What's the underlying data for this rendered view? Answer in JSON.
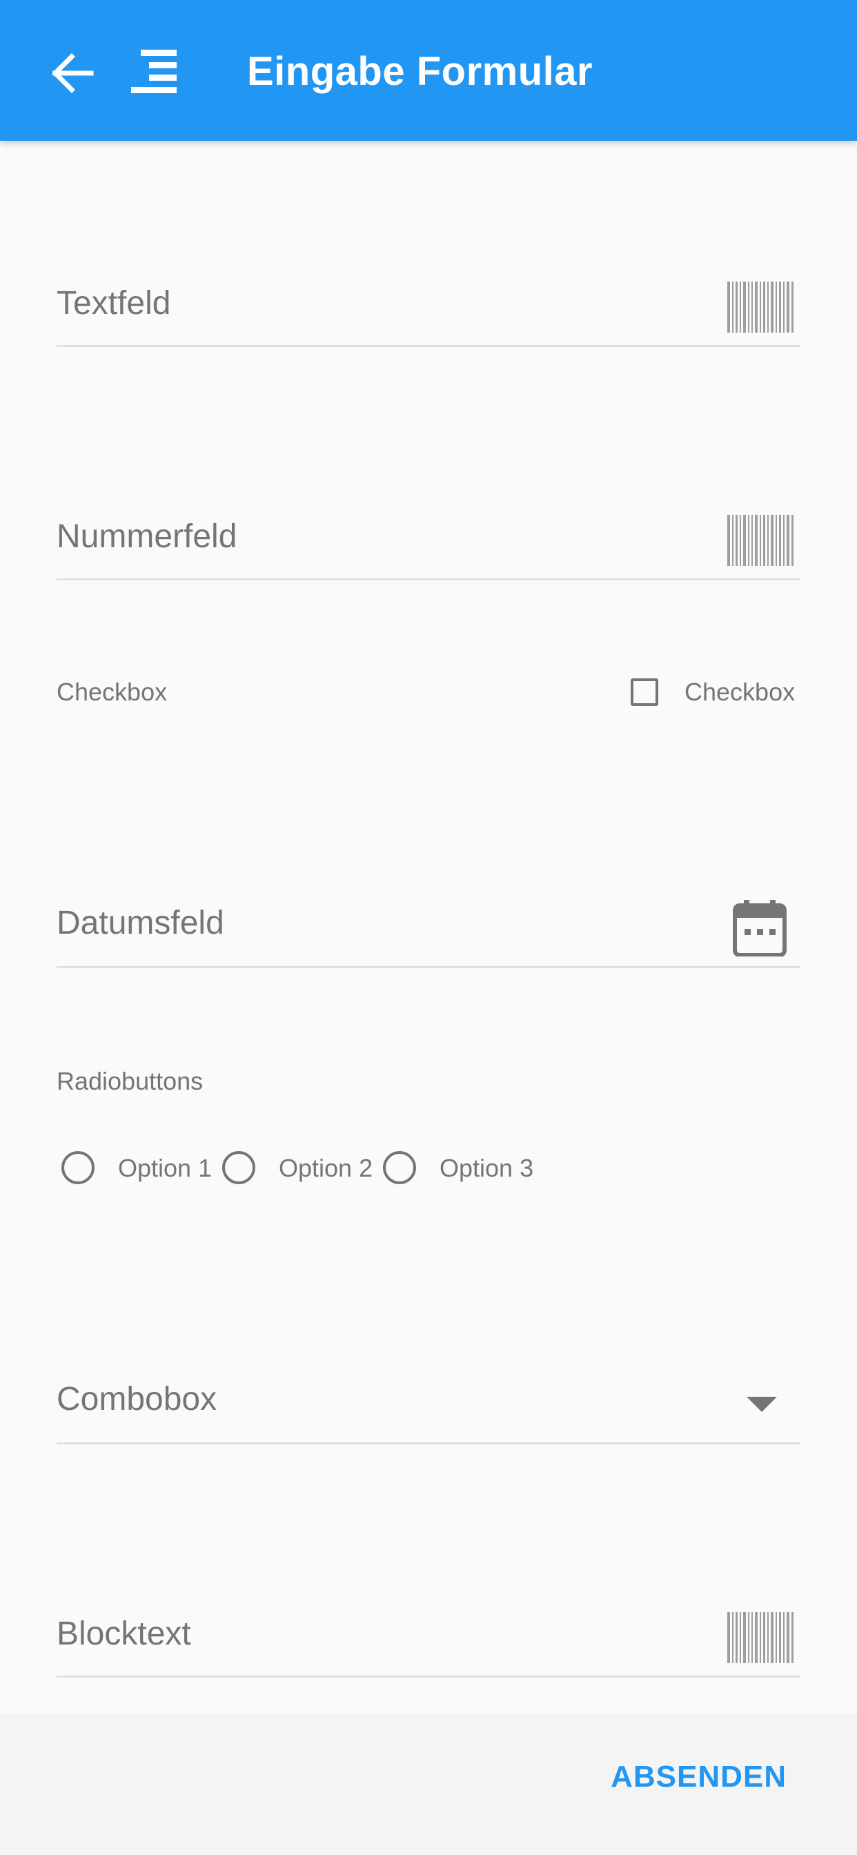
{
  "colors": {
    "accent": "#2196f3",
    "background": "#fafafa",
    "text_secondary": "#757575",
    "divider": "#e0e0e0",
    "footer_background": "#f4f4f4"
  },
  "appbar": {
    "title": "Eingabe Formular",
    "back_icon": "arrow-left-icon",
    "menu_icon": "align-right-icon"
  },
  "form": {
    "textfield": {
      "label": "Textfeld",
      "value": "",
      "icon": "barcode-icon"
    },
    "numberfield": {
      "label": "Nummerfeld",
      "value": "",
      "icon": "barcode-icon"
    },
    "checkbox": {
      "label": "Checkbox",
      "option_label": "Checkbox",
      "checked": false
    },
    "datefield": {
      "label": "Datumsfeld",
      "value": "",
      "icon": "calendar-icon"
    },
    "radio": {
      "label": "Radiobuttons",
      "options": [
        "Option 1",
        "Option 2",
        "Option 3"
      ],
      "selected": null
    },
    "combobox": {
      "label": "Combobox",
      "value": "",
      "icon": "dropdown-arrow-icon"
    },
    "blocktext": {
      "label": "Blocktext",
      "value": "",
      "icon": "barcode-icon"
    }
  },
  "footer": {
    "submit_label": "ABSENDEN"
  }
}
